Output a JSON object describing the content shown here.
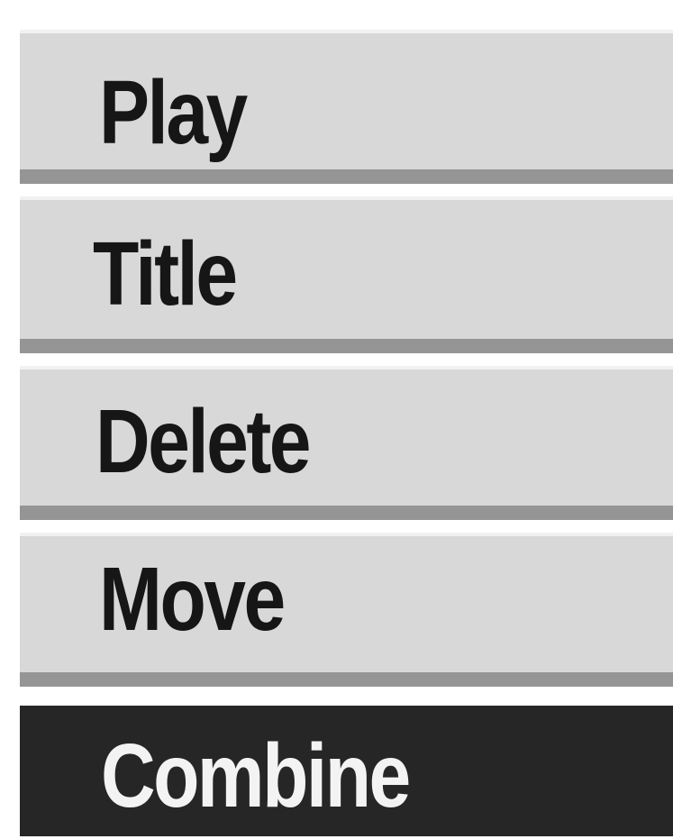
{
  "menu": {
    "items": [
      {
        "label": "Play",
        "selected": false
      },
      {
        "label": "Title",
        "selected": false
      },
      {
        "label": "Delete",
        "selected": false
      },
      {
        "label": "Move",
        "selected": false
      },
      {
        "label": "Combine",
        "selected": true
      }
    ]
  },
  "colors": {
    "item_background": "#d8d8d8",
    "item_separator": "#959595",
    "selected_background": "#262626",
    "selected_text": "#f3f3f3",
    "text": "#161616"
  }
}
